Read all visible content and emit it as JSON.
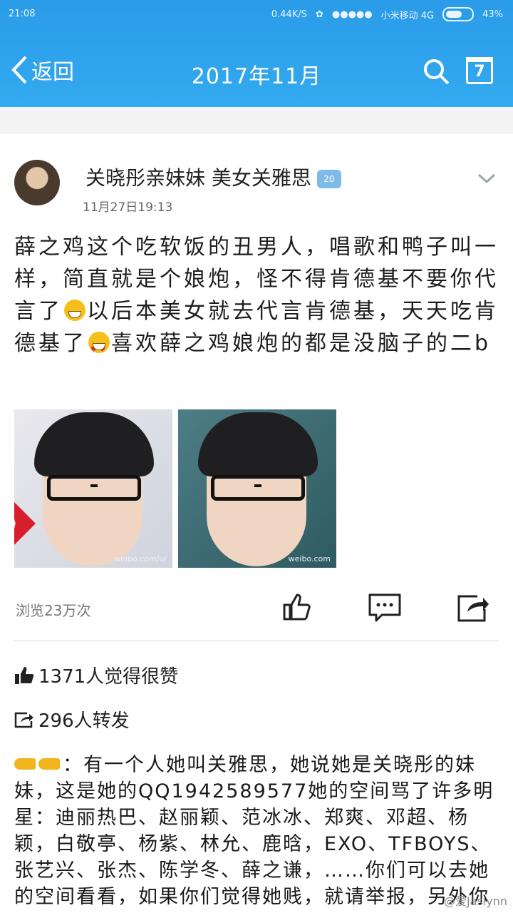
{
  "status_bar": {
    "time": "21:08",
    "speed": "0.44K/S",
    "carrier": "小米移动 4G",
    "battery": "43%"
  },
  "nav": {
    "back_label": "返回",
    "title": "2017年11月",
    "calendar_day": "7"
  },
  "post": {
    "author": "关晓彤亲妹妹 美女关雅思",
    "vip_badge": "20",
    "date": "11月27日19:13",
    "text_1": "薛之鸡这个吃软饭的丑男人，唱歌和鸭子叫一样，简直就是个娘炮，怪不得肯德基不要你代言了",
    "text_2": "以后本美女就去代言肯德基，天天吃肯德基了",
    "text_3": "喜欢薛之鸡娘炮的都是没脑子的二b",
    "views": "浏览23万次",
    "photo_watermark_1": "weibo.com/u/",
    "photo_watermark_2": "weibo.com"
  },
  "stats": {
    "likes": "1371人觉得很赞",
    "reposts": "296人转发"
  },
  "reply": {
    "text": "：有一个人她叫关雅思，她说她是关晓彤的妹妹，这是她的QQ1942589577她的空间骂了许多明星：迪丽热巴、赵丽颖、范冰冰、郑爽、邓超、杨颖，白敬亭、杨紫、林允、鹿晗，EXO、TFBOYS、张艺兴、张杰、陈学冬、薛之谦，……你们可以去她的空间看看，如果你们觉得她贱，就请举报，另外你"
  },
  "watermark": "@爱Jaslynn"
}
